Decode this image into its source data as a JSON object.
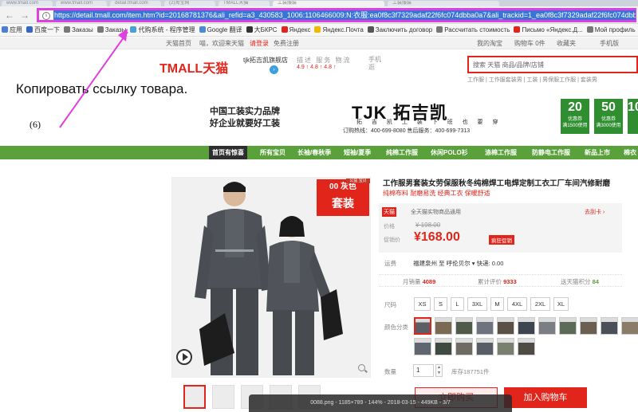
{
  "browser": {
    "tabs": [
      "www.tmall.com",
      "www.tmall.com",
      "detail.tmall.com",
      "(2)淘宝网",
      "TMALL天猫",
      "工装服装",
      "工装服装"
    ],
    "url": "https://detail.tmall.com/item.htm?id=20168781376&ali_refid=a3_430583_1006:1106466009:N:衣服:ea0f8c3f7329adaf22f6fc074dbba0a7&ali_trackid=1_ea0f8c3f7329adaf22f6fc074dbba0a7",
    "back_icon": "←",
    "forward_icon": "→",
    "info_icon": "i"
  },
  "bookmarks": [
    {
      "label": "应用",
      "color": "#4a7fd4"
    },
    {
      "label": "百度一下",
      "color": "#3366cc"
    },
    {
      "label": "Заказы",
      "color": "#777777"
    },
    {
      "label": "Заказы",
      "color": "#777777"
    },
    {
      "label": "代购系统 - 程序管理",
      "color": "#4aa0d4"
    },
    {
      "label": "Google 翻译",
      "color": "#4a8ad4"
    },
    {
      "label": "大БКРС",
      "color": "#333333"
    },
    {
      "label": "Яндекс",
      "color": "#e1251b"
    },
    {
      "label": "Яндекс.Почта",
      "color": "#f5b800"
    },
    {
      "label": "Заключить договор",
      "color": "#555555"
    },
    {
      "label": "Рассчитать стоимость",
      "color": "#777777"
    },
    {
      "label": "Письмо «Яндекс.Д...",
      "color": "#e1251b"
    },
    {
      "label": "Мой профиль",
      "color": "#777777"
    }
  ],
  "topnav": {
    "home": "天猫首页",
    "greeting": "喵，欢迎来天猫",
    "login": "请登录",
    "register": "免费注册",
    "my_tmall": "我的淘宝",
    "cart": "购物车 0件",
    "favorites": "收藏夹",
    "mobile": "手机版"
  },
  "header": {
    "logo": "TMALL天猫",
    "shop_name": "tjk拓吉凯旗舰店",
    "rate_title": "描述 服务 物流",
    "rate_values": "4.9 ↑  4.8 ↑  4.8 ↑",
    "mobile_shop": "手机逛",
    "search_placeholder": "搜索 天猫 商品/品牌/店铺",
    "hot_words": "工作服 | 工作服套装男 | 工装 | 男保服工作服 | 套装男"
  },
  "overlay": {
    "caption": "Копировать ссылку товара.",
    "step": "(6)"
  },
  "banner": {
    "slogan_line1": "中国工装实力品牌",
    "slogan_line2": "好企业就要好工装",
    "brand": "TJK 拓吉凯",
    "brand_sub": "拓 吉 凯 工 装   下 班 也 要 穿",
    "phones": "订购热线：400-699-8080    售后服务：400-699-7313",
    "coupons": [
      {
        "amount": "20",
        "text1": "优惠券",
        "text2": "满1500使用"
      },
      {
        "amount": "50",
        "text1": "优惠券",
        "text2": "满3000使用"
      },
      {
        "amount": "10",
        "text1": "",
        "text2": ""
      }
    ]
  },
  "menu": [
    "首页有惊喜",
    "所有宝贝",
    "长袖/春秋季",
    "短袖/夏季",
    "纯棉工作服",
    "休闲POLO衫",
    "涤棉工作服",
    "防静电工作服",
    "新品上市",
    "棉衣"
  ],
  "gallery": {
    "promo_small": "公益 宝贝",
    "promo_line1": "00 灰色",
    "promo_line2": "套装",
    "play_icon": "play",
    "zoom_icon": "zoom"
  },
  "product": {
    "title": "工作服男套装女劳保服秋冬纯棉焊工电焊定制工衣工厂车间汽修耐磨",
    "subtitle": "纯棉布料  耐磨易洗  经典工衣  保暖舒适",
    "tag": "天猫",
    "tag_text": "全天猫实物商品通用",
    "rules": "去刮卡 ›",
    "price_label": "价格",
    "old_price": "¥ 198.00",
    "promo_label": "促销价",
    "price": "¥168.00",
    "price_badge": "疯狂促销",
    "shipping_label": "运费",
    "shipping": "福建泉州  至  呼伦贝尔 ▾  快递: 0.00",
    "sales_label": "月销量",
    "sales": "4089",
    "reviews_label": "累计评价",
    "reviews": "9333",
    "points_label": "送天猫积分",
    "points": "84",
    "size_label": "尺码",
    "sizes": [
      "XS",
      "S",
      "L",
      "3XL",
      "M",
      "4XL",
      "2XL",
      "XL"
    ],
    "color_label": "颜色分类",
    "qty_label": "数量",
    "qty": "1",
    "stock": "库存187751件",
    "buy_now": "立即购买",
    "add_cart": "加入购物车"
  },
  "viewer": {
    "status": "0088.png - 1185×789 - 144% - 2018-03-15 - 449KB - 3/7"
  }
}
